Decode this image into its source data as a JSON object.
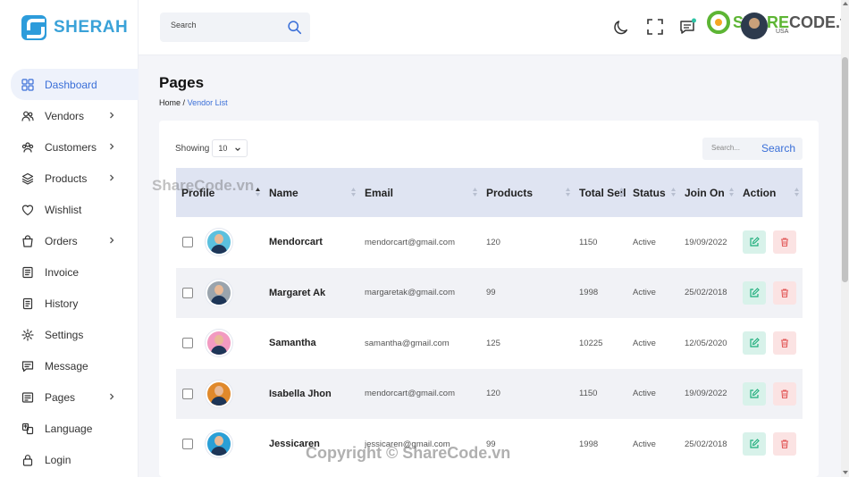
{
  "brand": {
    "name": "SHERAH"
  },
  "header": {
    "search_placeholder": "Search",
    "user_sub": "USA",
    "watermark_a": "SHARE",
    "watermark_b": "CODE.vn"
  },
  "sidebar": {
    "items": [
      {
        "label": "Dashboard",
        "icon": "dashboard-icon",
        "arrow": false
      },
      {
        "label": "Vendors",
        "icon": "vendors-icon",
        "arrow": true
      },
      {
        "label": "Customers",
        "icon": "customers-icon",
        "arrow": true
      },
      {
        "label": "Products",
        "icon": "products-icon",
        "arrow": true
      },
      {
        "label": "Wishlist",
        "icon": "heart-icon",
        "arrow": false
      },
      {
        "label": "Orders",
        "icon": "orders-icon",
        "arrow": true
      },
      {
        "label": "Invoice",
        "icon": "invoice-icon",
        "arrow": false
      },
      {
        "label": "History",
        "icon": "history-icon",
        "arrow": false
      },
      {
        "label": "Settings",
        "icon": "gear-icon",
        "arrow": false
      },
      {
        "label": "Message",
        "icon": "message-icon",
        "arrow": false
      },
      {
        "label": "Pages",
        "icon": "pages-icon",
        "arrow": true
      },
      {
        "label": "Language",
        "icon": "language-icon",
        "arrow": false
      },
      {
        "label": "Login",
        "icon": "lock-icon",
        "arrow": false
      }
    ]
  },
  "page": {
    "title": "Pages",
    "breadcrumb_home": "Home",
    "breadcrumb_sep": "/",
    "breadcrumb_current": "Vendor List"
  },
  "table_controls": {
    "showing_label": "Showing",
    "showing_value": "10",
    "search_placeholder": "Search...",
    "search_button": "Search"
  },
  "table": {
    "headers": [
      "Profile",
      "Name",
      "Email",
      "Products",
      "Total Sell",
      "Status",
      "Join On",
      "Action"
    ],
    "rows": [
      {
        "name": "Mendorcart",
        "email": "mendorcart@gmail.com",
        "products": "120",
        "total_sell": "1150",
        "status": "Active",
        "join_on": "19/09/2022",
        "avatar_color": "#5bc0de"
      },
      {
        "name": "Margaret Ak",
        "email": "margaretak@gmail.com",
        "products": "99",
        "total_sell": "1998",
        "status": "Active",
        "join_on": "25/02/2018",
        "avatar_color": "#9aa4ad"
      },
      {
        "name": "Samantha",
        "email": "samantha@gmail.com",
        "products": "125",
        "total_sell": "10225",
        "status": "Active",
        "join_on": "12/05/2020",
        "avatar_color": "#f29ac1"
      },
      {
        "name": "Isabella Jhon",
        "email": "mendorcart@gmail.com",
        "products": "120",
        "total_sell": "1150",
        "status": "Active",
        "join_on": "19/09/2022",
        "avatar_color": "#e0892b"
      },
      {
        "name": "Jessicaren",
        "email": "jessicaren@gmail.com",
        "products": "99",
        "total_sell": "1998",
        "status": "Active",
        "join_on": "25/02/2018",
        "avatar_color": "#2a9fd6"
      }
    ]
  },
  "watermarks": {
    "overlay": "ShareCode.vn",
    "copyright": "Copyright © ShareCode.vn"
  },
  "colors": {
    "accent": "#3a6fd8",
    "brand": "#3aa2d8",
    "edit_bg": "#d8f2ea",
    "delete_bg": "#fbe3e3"
  }
}
